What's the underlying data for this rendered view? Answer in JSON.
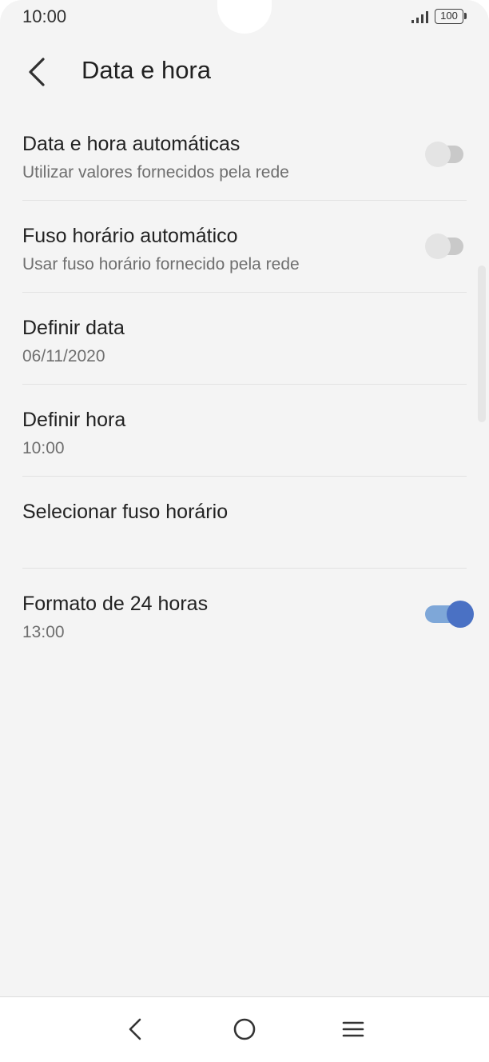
{
  "status_bar": {
    "time": "10:00",
    "battery": "100",
    "icons": [
      "signal-icon",
      "battery-icon"
    ]
  },
  "header": {
    "title": "Data e hora",
    "back_icon": "back-arrow-icon"
  },
  "settings": [
    {
      "title": "Data e hora automáticas",
      "subtitle": "Utilizar valores fornecidos pela rede",
      "toggle": "off"
    },
    {
      "title": "Fuso horário automático",
      "subtitle": "Usar fuso horário fornecido pela rede",
      "toggle": "off"
    },
    {
      "title": "Definir data",
      "subtitle": "06/11/2020"
    },
    {
      "title": "Definir hora",
      "subtitle": "10:00"
    },
    {
      "title": "Selecionar fuso horário",
      "subtitle": ""
    },
    {
      "title": "Formato de 24 horas",
      "subtitle": "13:00",
      "toggle": "on"
    }
  ],
  "colors": {
    "background": "#f4f4f4",
    "toggle_on_thumb": "#4a71c4",
    "toggle_on_track": "#7ea7d8",
    "toggle_off_track": "#c9c9c9"
  },
  "nav_bar": {
    "icons": [
      "nav-back-icon",
      "nav-home-icon",
      "nav-recents-icon"
    ]
  }
}
